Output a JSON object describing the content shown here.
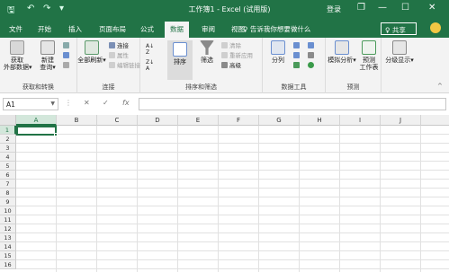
{
  "titlebar": {
    "title": "工作簿1 - Excel (试用版)",
    "login": "登录",
    "qat": {
      "save": "🖫",
      "undo": "↶",
      "redo": "↷",
      "customize": "▾"
    },
    "window": {
      "restore": "❐",
      "minimize": "—",
      "maximize": "☐",
      "close": "✕"
    }
  },
  "tabs": {
    "items": [
      "文件",
      "开始",
      "插入",
      "页面布局",
      "公式",
      "数据",
      "审阅",
      "视图"
    ],
    "active": "数据",
    "tell_me": "♀ 告诉我你想要做什么",
    "share": "♀ 共享"
  },
  "ribbon": {
    "groups": {
      "get_external": {
        "label": "获取和转换",
        "external": "获取\n外部数据▾",
        "new_query": "新建\n查询▾"
      },
      "connections": {
        "label": "连接",
        "refresh_all": "全部刷新▾",
        "connections": "连接",
        "properties": "属性",
        "edit_links": "编辑链接"
      },
      "sort_filter": {
        "label": "排序和筛选",
        "sort": "排序",
        "filter": "筛选",
        "clear": "清除",
        "reapply": "重新应用",
        "advanced": "高级"
      },
      "data_tools": {
        "label": "数据工具",
        "text_to_columns": "分列"
      },
      "forecast": {
        "label": "预测",
        "what_if": "模拟分析▾",
        "forecast_sheet": "预测\n工作表"
      },
      "outline": {
        "label": "",
        "outline": "分级显示▾"
      }
    },
    "collapse": "^"
  },
  "formula_bar": {
    "name_box": "A1",
    "cancel": "✕",
    "enter": "✓",
    "fx": "fx",
    "value": ""
  },
  "grid": {
    "columns": [
      "A",
      "B",
      "C",
      "D",
      "E",
      "F",
      "G",
      "H",
      "I",
      "J"
    ],
    "rows": [
      "1",
      "2",
      "3",
      "4",
      "5",
      "6",
      "7",
      "8",
      "9",
      "10",
      "11",
      "12",
      "13",
      "14",
      "15",
      "16"
    ],
    "active_cell": "A1"
  },
  "colors": {
    "accent": "#217346",
    "ribbon_bg": "#f3f3f3",
    "header_bg": "#f0f0f0",
    "gridline": "#e1e1e1"
  }
}
